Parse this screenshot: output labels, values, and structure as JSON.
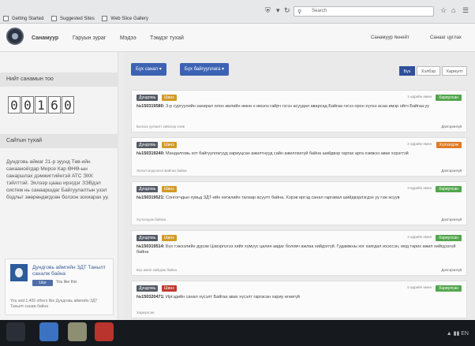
{
  "browser": {
    "bookmarks": [
      "Getting Started",
      "Suggested Sites",
      "Web Slice Gallery"
    ],
    "search_placeholder": "Search",
    "icons": [
      "shield-icon",
      "refresh-icon",
      "star-icon",
      "home-icon",
      "menu-icon"
    ]
  },
  "nav": {
    "items": [
      "Санамуур",
      "Гаруын зураг",
      "Мэдээ",
      "Тэмдэг тухай"
    ],
    "right": [
      "Санамуур №нейт",
      "Санааг цуглах"
    ]
  },
  "sidebar": {
    "visitors_title": "Нийт санамын тоо",
    "visitor_digits": [
      "0",
      "0",
      "1",
      "6",
      "0"
    ],
    "about_title": "Сайтын тухай",
    "about_text": "Дундговь аймаг 21-р зуунд Төв-ийн санааноёгдар Мерсе Кар ӨНӨ-ын санаршлах дэмжигтийнтэй АТС ЭХК тэйлттэй. Эхлээр цааш ирэгдэг ЗЭВдэл систем нь санааршдаг Байгуулалтын узэл бодлыг зөөрөндөгдсөн болзон зохиарах уу.",
    "fb": {
      "title": "Дундговь аймгийн ЗДТ Танылт саналж байна",
      "like": "Like",
      "count": "You like this",
      "footer": "You and 1,405 others like Дундговь аймгийн ЗДТ Танылт санаж байна"
    }
  },
  "main": {
    "buttons": [
      "Бүх санал",
      "Бүх байгууллага"
    ],
    "filters": [
      "Бүх",
      "Хэлбэр",
      "Хариулт"
    ],
    "items": [
      {
        "tag1": "Дундговь",
        "tag2": "Шинэ",
        "meta": "1 өдрийн өмнө",
        "status": "Хариулсан",
        "id": "№150319580:",
        "text": "3-р сургуулийн захирал олон жилийн өмнө н имэлэ гайрч гэгээ асуудал аварсад Байгаа гэгээ орон хүлээ асаа имэр ойгч Байгаа уу",
        "foot": "Болзох уулзалт хийхээр очив",
        "link": "Дэлгэрэнгүй"
      },
      {
        "tag1": "Дундговь",
        "tag2": "Шинэ",
        "meta": "2 өдрийн өмнө",
        "status": "Хүлээгдэж",
        "id": "№150319240:",
        "text": "Мандалговь хот байгууллагууд хариуцсан ажилтнууд сайн ажиллахгүй байна шийдвэр гаргах арга хэмжээ авах хэрэгтэй",
        "foot": "Эхлэл мэдээлэл Байгаа байна",
        "link": "Дэлгэрэнгүй"
      },
      {
        "tag1": "Дундговь",
        "tag2": "Шинэ",
        "meta": "3 өдрийн өмнө",
        "status": "Хариулсан",
        "id": "№150319521:",
        "text": "Сонгогчдын хувьд ЗДТ-ийн хөгжлийн талаар асуулт байна. Хэрэв иргэд санал гаргавал шийдвэрлэгдэх уу гэж асуув",
        "foot": "Хүлээгдэж байгаа",
        "link": "Дэлгэрэнгүй"
      },
      {
        "tag1": "Дундговь",
        "tag2": "Шинэ",
        "meta": "4 өдрийн өмнө",
        "status": "Хариулсан",
        "id": "№150319514:",
        "text": "Бүх тэжээлийн дүрэм Цэвэрлэгээ хийх хүмүүс цалин авдаг боловч ажлаа хийдэггүй. Гудамжны хог хаягдал ихэссэн, мод тарих ажил хийгдээгүй байна",
        "foot": "Бүх ажил хийгдэж байна",
        "link": "Дэлгэрэнгүй"
      },
      {
        "tag1": "Дундговь",
        "tag2": "Шинэ",
        "meta": "5 өдрийн өмнө",
        "status": "Хариулсан",
        "id": "№150320471:",
        "text": "Иргэдийн санал хүсэлт Байгаа авах хүсэлт гаргасан хариу өгөөгүй",
        "foot": "Хариулсан",
        "link": "Дэлгэрэнгүй"
      }
    ]
  },
  "taskbar": {
    "tray": "EN"
  }
}
